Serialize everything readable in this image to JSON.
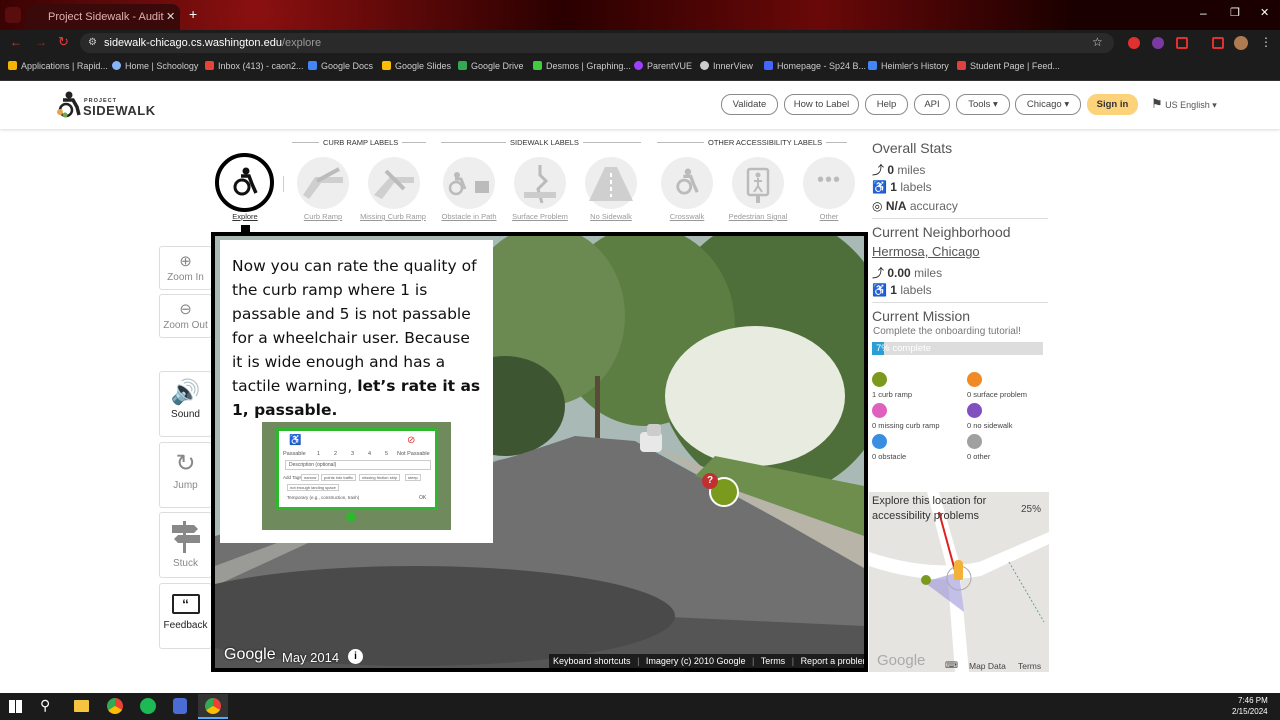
{
  "browser": {
    "tab_title": "Project Sidewalk - Audit",
    "url_host": "sidewalk-chicago.cs.washington.edu",
    "url_path": "/explore",
    "bookmarks": [
      "Applications | Rapid...",
      "Home | Schoology",
      "Inbox (413) - caon2...",
      "Google Docs",
      "Google Slides",
      "Google Drive",
      "Desmos | Graphing...",
      "ParentVUE",
      "InnerView",
      "Homepage - Sp24 B...",
      "Heimler's History",
      "Student Page | Feed..."
    ],
    "bookmark_colors": [
      "#f6b400",
      "#8ab4f8",
      "#ea4335",
      "#4285f4",
      "#fbbc04",
      "#34a853",
      "#3ecf3e",
      "#a040ff",
      "#cccccc",
      "#4466ff",
      "#4285f4",
      "#e04040"
    ]
  },
  "header": {
    "logo_small": "PROJECT",
    "logo_big": "SIDEWALK",
    "nav": [
      "Validate",
      "How to Label",
      "Help",
      "API",
      "Tools ▾",
      "Chicago ▾"
    ],
    "signin": "Sign in",
    "language": "US English ▾"
  },
  "labels": {
    "groups": [
      "CURB RAMP LABELS",
      "SIDEWALK LABELS",
      "OTHER ACCESSIBILITY LABELS"
    ],
    "explore": "Explore",
    "items": [
      "Curb Ramp",
      "Missing Curb Ramp",
      "Obstacle in Path",
      "Surface Problem",
      "No Sidewalk",
      "Crosswalk",
      "Pedestrian Signal",
      "Other"
    ]
  },
  "controls": {
    "zoom_in": "Zoom In",
    "zoom_out": "Zoom Out",
    "sound": "Sound",
    "jump": "Jump",
    "stuck": "Stuck",
    "feedback": "Feedback"
  },
  "tutorial": {
    "text": "Now you can rate the quality of the curb ramp where 1 is passable and 5 is not passable for a wheelchair user. Because it is wide enough and has a tactile warning, ",
    "bold": "let’s rate it as 1, passable.",
    "passable": "Passable",
    "not_passable": "Not Passable",
    "ratings": [
      "1",
      "2",
      "3",
      "4",
      "5"
    ],
    "description_placeholder": "Description (optional)",
    "tags_label": "Add Tags",
    "tags": [
      "narrow",
      "points into traffic",
      "missing friction strip",
      "steep",
      "not enough landing space"
    ],
    "temporary": "Temporary (e.g., construction, trash)",
    "ok": "OK"
  },
  "pano": {
    "google": "Google",
    "date": "May 2014",
    "footer": [
      "Keyboard shortcuts",
      "Imagery (c) 2010 Google",
      "Terms",
      "Report a problem"
    ]
  },
  "overall_stats": {
    "title": "Overall Stats",
    "miles": "0",
    "miles_unit": "miles",
    "labels": "1",
    "labels_unit": "labels",
    "accuracy": "N/A",
    "accuracy_unit": "accuracy"
  },
  "neighborhood": {
    "title": "Current Neighborhood",
    "name": "Hermosa, Chicago",
    "miles": "0.00",
    "miles_unit": "miles",
    "labels": "1",
    "labels_unit": "labels"
  },
  "mission": {
    "title": "Current Mission",
    "subtitle": "Complete the onboarding tutorial!",
    "progress_label": "7% complete",
    "progress_fraction": 0.07,
    "counts": [
      {
        "text": "1 curb ramp",
        "color": "#7a9a1e"
      },
      {
        "text": "0 surface problem",
        "color": "#f08a24"
      },
      {
        "text": "0 missing curb ramp",
        "color": "#e060c0"
      },
      {
        "text": "0 no sidewalk",
        "color": "#8050c0"
      },
      {
        "text": "0 obstacle",
        "color": "#3a8ee0"
      },
      {
        "text": "0 other",
        "color": "#a0a0a0"
      }
    ]
  },
  "minimap": {
    "caption": "Explore this location for accessibility problems",
    "percent": "25%",
    "google": "Google",
    "map_data": "Map Data",
    "terms": "Terms"
  },
  "taskbar": {
    "time": "7:46 PM",
    "date": "2/15/2024"
  }
}
